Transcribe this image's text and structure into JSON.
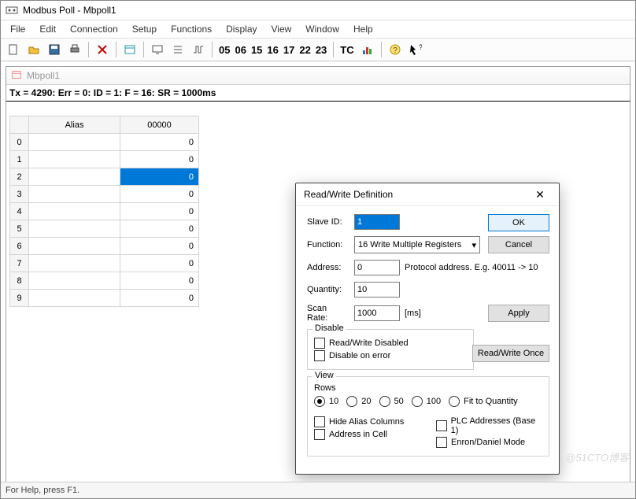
{
  "title": "Modbus Poll - Mbpoll1",
  "menu": [
    "File",
    "Edit",
    "Connection",
    "Setup",
    "Functions",
    "Display",
    "View",
    "Window",
    "Help"
  ],
  "toolbar_nums": [
    "05",
    "06",
    "15",
    "16",
    "17",
    "22",
    "23"
  ],
  "toolbar_tc": "TC",
  "child": {
    "title": "Mbpoll1",
    "status": "Tx = 4290: Err = 0: ID = 1: F = 16: SR = 1000ms"
  },
  "columns": {
    "alias": "Alias",
    "val": "00000"
  },
  "rows": [
    {
      "n": "0",
      "alias": "",
      "val": "0",
      "sel": false
    },
    {
      "n": "1",
      "alias": "",
      "val": "0",
      "sel": false
    },
    {
      "n": "2",
      "alias": "",
      "val": "0",
      "sel": true
    },
    {
      "n": "3",
      "alias": "",
      "val": "0",
      "sel": false
    },
    {
      "n": "4",
      "alias": "",
      "val": "0",
      "sel": false
    },
    {
      "n": "5",
      "alias": "",
      "val": "0",
      "sel": false
    },
    {
      "n": "6",
      "alias": "",
      "val": "0",
      "sel": false
    },
    {
      "n": "7",
      "alias": "",
      "val": "0",
      "sel": false
    },
    {
      "n": "8",
      "alias": "",
      "val": "0",
      "sel": false
    },
    {
      "n": "9",
      "alias": "",
      "val": "0",
      "sel": false
    }
  ],
  "dialog": {
    "title": "Read/Write Definition",
    "slave_lbl": "Slave ID:",
    "slave_val": "1",
    "func_lbl": "Function:",
    "func_val": "16 Write Multiple Registers",
    "addr_lbl": "Address:",
    "addr_val": "0",
    "addr_hint": "Protocol address. E.g. 40011 -> 10",
    "qty_lbl": "Quantity:",
    "qty_val": "10",
    "scan_lbl": "Scan Rate:",
    "scan_val": "1000",
    "scan_unit": "[ms]",
    "disable_grp": "Disable",
    "chk_rw": "Read/Write Disabled",
    "chk_err": "Disable on error",
    "view_grp": "View",
    "rows_lbl": "Rows",
    "row_opts": [
      "10",
      "20",
      "50",
      "100",
      "Fit to Quantity"
    ],
    "row_sel": "10",
    "chk_hide": "Hide Alias Columns",
    "chk_plc": "PLC Addresses (Base 1)",
    "chk_cell": "Address in Cell",
    "chk_enron": "Enron/Daniel Mode",
    "btn_ok": "OK",
    "btn_cancel": "Cancel",
    "btn_apply": "Apply",
    "btn_once": "Read/Write Once"
  },
  "statusbar": "For Help, press F1.",
  "watermark": "@51CTO博客"
}
